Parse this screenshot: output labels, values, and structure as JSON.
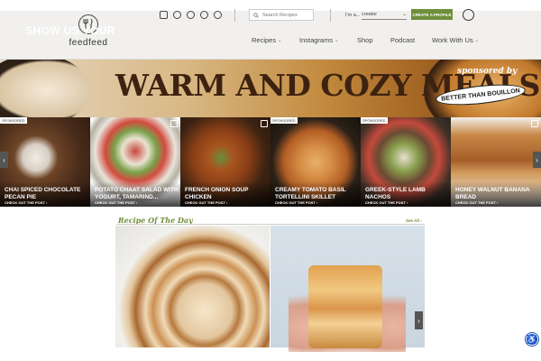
{
  "header": {
    "logo_text": "feedfeed",
    "search_placeholder": "Search Recipes",
    "im_a_label": "I'm a...",
    "role_value": "creator",
    "create_button": "CREATE A PROFILE",
    "socials": [
      "instagram-icon",
      "tiktok-icon",
      "pinterest-icon",
      "facebook-icon",
      "twitter-icon"
    ]
  },
  "nav": {
    "items": [
      {
        "label": "Recipes",
        "has_dropdown": true
      },
      {
        "label": "Instagrams",
        "has_dropdown": true
      },
      {
        "label": "Shop",
        "has_dropdown": false
      },
      {
        "label": "Podcast",
        "has_dropdown": false
      },
      {
        "label": "Work With Us",
        "has_dropdown": true
      }
    ]
  },
  "banner": {
    "left_text": "SHOW US YOUR",
    "main_text": "WARM AND COZY MEALS",
    "sponsored_by": "sponsored by",
    "sponsor": "BETTER THAN BOUILLON"
  },
  "carousel": {
    "cards": [
      {
        "title": "CHAI SPICED CHOCOLATE PECAN PIE",
        "link": "CHECK OUT THE POST ›",
        "sponsored": "SPONSORED",
        "color": "#5a3a26"
      },
      {
        "title": "POTATO CHAAT SALAD WITH YOGURT, TAMARIND...",
        "link": "CHECK OUT THE POST ›",
        "sponsored": "",
        "color": "#6b7a52"
      },
      {
        "title": "FRENCH ONION SOUP CHICKEN",
        "link": "CHECK OUT THE POST ›",
        "sponsored": "",
        "color": "#8a4b22"
      },
      {
        "title": "CREAMY TOMATO BASIL TORTELLINI SKILLET",
        "link": "CHECK OUT THE POST ›",
        "sponsored": "SPONSORED",
        "color": "#8e5a2e"
      },
      {
        "title": "GREEK-STYLE LAMB NACHOS",
        "link": "CHECK OUT THE POST ›",
        "sponsored": "SPONSORED",
        "color": "#6a5a48"
      },
      {
        "title": "HONEY WALNUT BANANA BREAD",
        "link": "CHECK OUT THE POST ›",
        "sponsored": "",
        "color": "#a8743f"
      }
    ]
  },
  "rotd": {
    "title": "Recipe Of The Day",
    "see_all": "See All ›"
  },
  "colors": {
    "accent_green": "#6f8f3a",
    "a11y_blue": "#1b4eb5"
  }
}
